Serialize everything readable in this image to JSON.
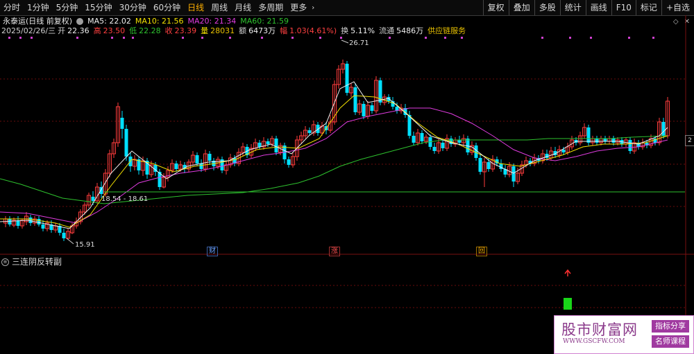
{
  "toolbar": {
    "periods": [
      "分时",
      "1分钟",
      "5分钟",
      "15分钟",
      "30分钟",
      "60分钟",
      "日线",
      "周线",
      "月线",
      "多周期",
      "更多"
    ],
    "active_period": "日线",
    "tools": [
      "复权",
      "叠加",
      "多股",
      "统计",
      "画线",
      "F10",
      "标记",
      "+自选"
    ]
  },
  "stock": {
    "title": "永泰运(日线 前复权)",
    "ma5_label": "MA5:",
    "ma5": "22.02",
    "ma10_label": "MA10:",
    "ma10": "21.56",
    "ma20_label": "MA20:",
    "ma20": "21.34",
    "ma60_label": "MA60:",
    "ma60": "21.59"
  },
  "quote": {
    "date": "2025/02/26/三",
    "open_label": "开",
    "open": "22.36",
    "high_label": "高",
    "high": "23.50",
    "low_label": "低",
    "low": "22.28",
    "close_label": "收",
    "close": "23.39",
    "volume_label": "量",
    "volume": "28031",
    "amount_label": "额",
    "amount": "6473万",
    "change_label": "幅",
    "change": "1.03(4.61%)",
    "turnover_label": "换",
    "turnover": "5.11%",
    "float_label": "流通",
    "float": "5486万",
    "concept": "供应链服务"
  },
  "chart_annotations": {
    "high_marker": "26.71",
    "low_marker": "15.91",
    "range_label": "18.54 - 18.61"
  },
  "event_marks": {
    "cai": "财",
    "zhang": "涨",
    "hui": "回"
  },
  "sub_chart": {
    "title": "三连阴反转副"
  },
  "window_controls": {
    "diamond": "◇",
    "close": "✕"
  },
  "edge_label": "2",
  "watermark": {
    "title": "股市财富网",
    "url": "WWW.GSCFW.COM",
    "tag1": "指标分享",
    "tag2": "名师课程"
  },
  "colors": {
    "up": "#ff3c3c",
    "down": "#00e0ff",
    "ma5": "#f0f0f0",
    "ma10": "#f3e000",
    "ma20": "#e03ce0",
    "ma60": "#2ec22e",
    "grid": "#7a1010",
    "signal_green": "#19d619",
    "signal_red": "#ff3030"
  }
}
